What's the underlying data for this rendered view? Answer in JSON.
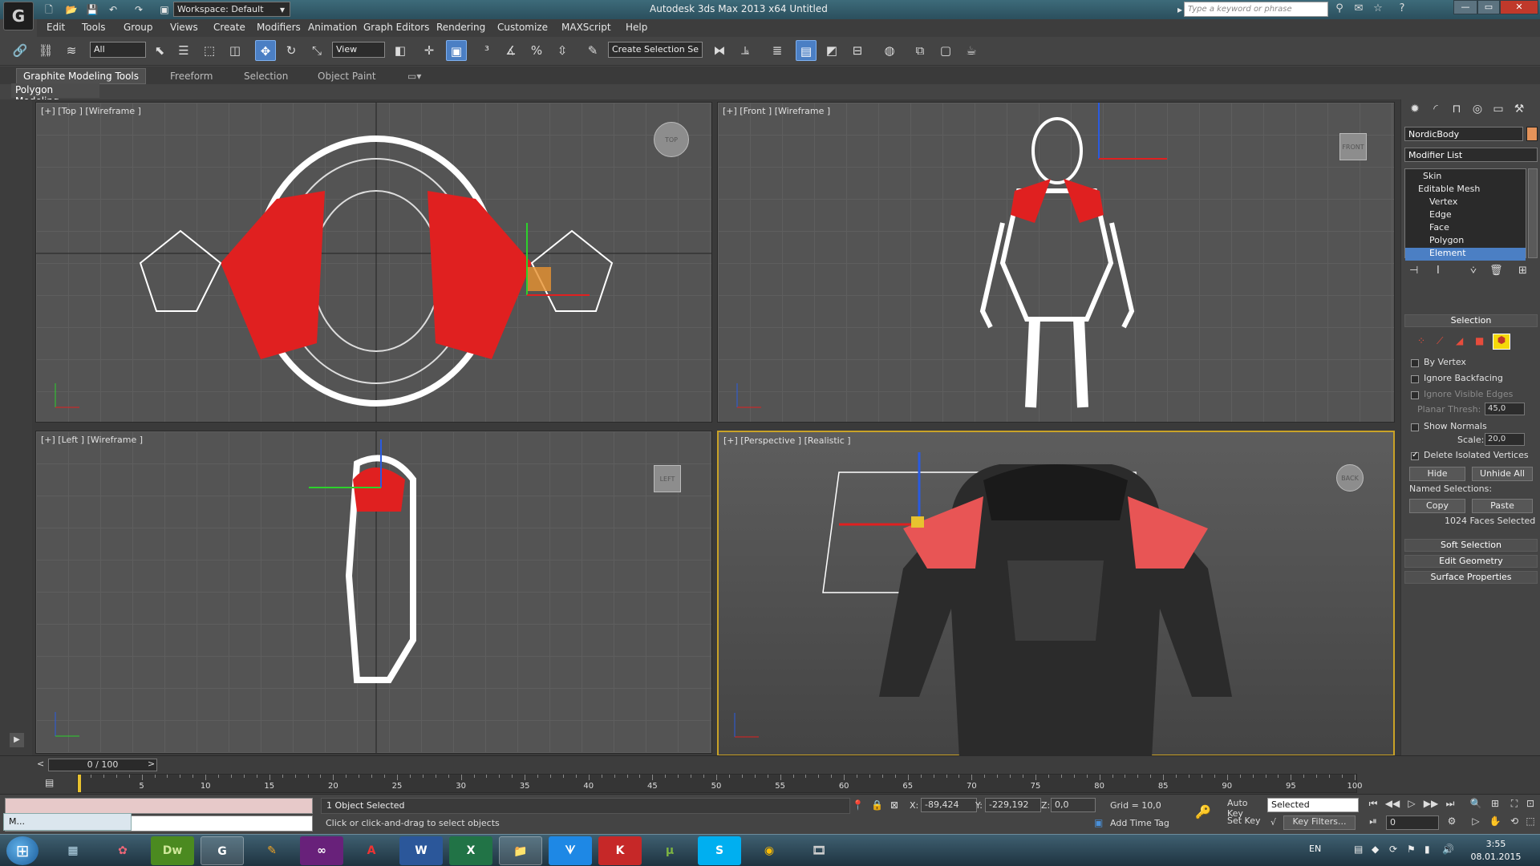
{
  "title_bar": {
    "app_logo": "G",
    "workspace": "Workspace: Default",
    "title": "Autodesk 3ds Max  2013 x64    Untitled",
    "search_placeholder": "Type a keyword or phrase"
  },
  "menu": [
    "Edit",
    "Tools",
    "Group",
    "Views",
    "Create",
    "Modifiers",
    "Animation",
    "Graph Editors",
    "Rendering",
    "Customize",
    "MAXScript",
    "Help"
  ],
  "toolbar": {
    "filter": "All",
    "ref_coord": "View",
    "named_selection": "Create Selection Se"
  },
  "ribbon": {
    "tabs": [
      "Graphite Modeling Tools",
      "Freeform",
      "Selection",
      "Object Paint"
    ],
    "panel": "Polygon Modeling"
  },
  "viewports": {
    "top": "[+] [Top ] [Wireframe ]",
    "front": "[+] [Front ] [Wireframe ]",
    "left": "[+] [Left ] [Wireframe ]",
    "perspective": "[+] [Perspective ] [Realistic ]",
    "cube_top": "TOP",
    "cube_front": "FRONT",
    "cube_left": "LEFT",
    "cube_back": "BACK"
  },
  "command_panel": {
    "object_name": "NordicBody",
    "object_color": "#e4935a",
    "modifier_list": "Modifier List",
    "stack": [
      "Skin",
      "Editable Mesh",
      "Vertex",
      "Edge",
      "Face",
      "Polygon",
      "Element"
    ],
    "selection_rollout": "Selection",
    "by_vertex": "By Vertex",
    "ignore_backfacing": "Ignore Backfacing",
    "ignore_visible_edges": "Ignore Visible Edges",
    "planar_thresh_label": "Planar Thresh:",
    "planar_thresh_value": "45,0",
    "show_normals": "Show Normals",
    "scale_label": "Scale:",
    "scale_value": "20,0",
    "delete_isolated": "Delete Isolated Vertices",
    "hide": "Hide",
    "unhide_all": "Unhide All",
    "named_selections": "Named Selections:",
    "copy": "Copy",
    "paste": "Paste",
    "faces_selected": "1024 Faces Selected",
    "soft_selection": "Soft Selection",
    "edit_geometry": "Edit Geometry",
    "surface_properties": "Surface Properties"
  },
  "timeline": {
    "slider": "0 / 100",
    "ticks": [
      5,
      10,
      15,
      20,
      25,
      30,
      35,
      40,
      45,
      50,
      55,
      60,
      65,
      70,
      75,
      80,
      85,
      90,
      95,
      100
    ]
  },
  "status": {
    "selection": "1 Object Selected",
    "prompt": "Click or click-and-drag to select objects",
    "x_label": "X:",
    "x": "-89,424",
    "y_label": "Y:",
    "y": "-229,192",
    "z_label": "Z:",
    "z": "0,0",
    "grid": "Grid = 10,0",
    "add_time_tag": "Add Time Tag",
    "auto_key": "Auto Key",
    "selected": "Selected",
    "set_key": "Set Key",
    "key_filters": "Key Filters...",
    "frame": "0"
  },
  "taskbar": {
    "mini_window": "M...",
    "lang": "EN",
    "time": "3:55",
    "date": "08.01.2015"
  }
}
